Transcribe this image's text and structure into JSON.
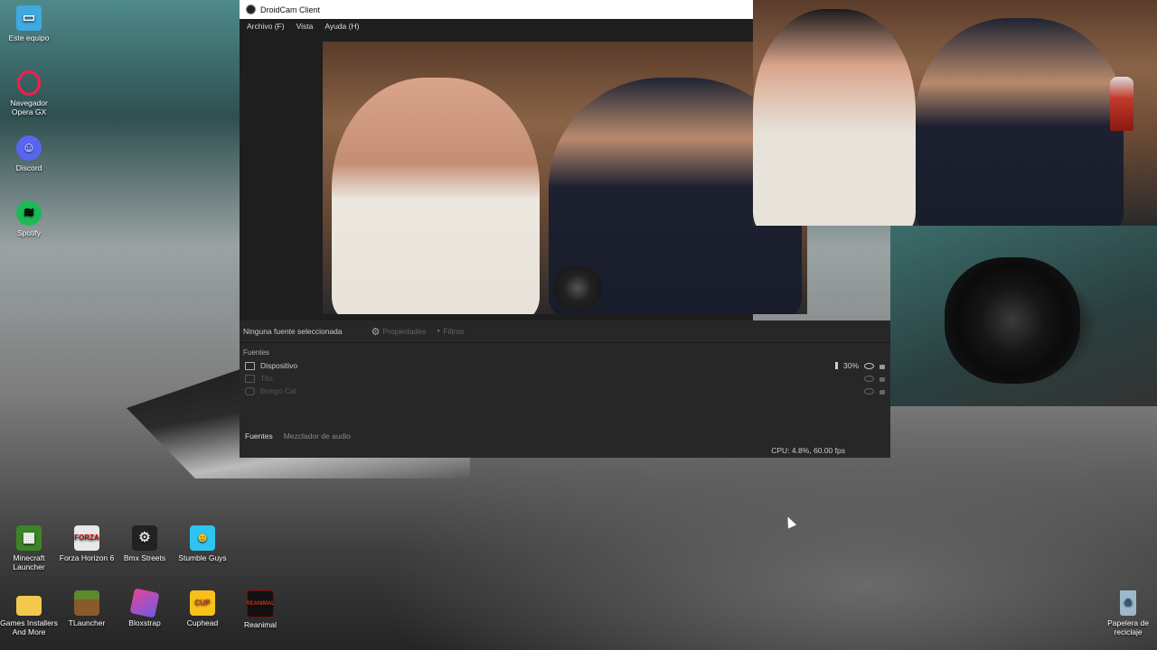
{
  "desktop_icons": [
    {
      "label": "Este equipo",
      "icon": "monitor-icon",
      "color": "#3fa9e0"
    },
    {
      "label": "Navegador Opera GX",
      "icon": "opera-gx-icon",
      "color": "#ff1b4d"
    },
    {
      "label": "Discord",
      "icon": "discord-icon",
      "color": "#5865f2"
    },
    {
      "label": "Spotify",
      "icon": "spotify-icon",
      "color": "#1db954"
    },
    {
      "label": "Minecraft Launcher",
      "icon": "minecraft-icon",
      "color": "#3c8527"
    },
    {
      "label": "Forza Horizon 6",
      "icon": "forza-icon",
      "color": "#e8e8e8"
    },
    {
      "label": "Bmx Streets",
      "icon": "gear-icon",
      "color": "#222222"
    },
    {
      "label": "Stumble Guys",
      "icon": "stumble-guys-icon",
      "color": "#2ec4f1"
    },
    {
      "label": "Games Installers And More",
      "icon": "folder-icon",
      "color": "#f2c94c"
    },
    {
      "label": "TLauncher",
      "icon": "grass-block-icon",
      "color": "#5c8a2c"
    },
    {
      "label": "Bloxstrap",
      "icon": "bloxstrap-icon",
      "color": "#8e44ad"
    },
    {
      "label": "Cuphead",
      "icon": "cuphead-icon",
      "color": "#f6c21a"
    },
    {
      "label": "Reanimal",
      "icon": "reanimal-icon",
      "color": "#8b0000"
    },
    {
      "label": "Papelera de reciclaje",
      "icon": "recycle-bin-icon",
      "color": "#9fb8c8"
    }
  ],
  "window": {
    "title": "DroidCam Client",
    "menu": [
      "Archivo (F)",
      "Vista",
      "Ayuda (H)"
    ]
  },
  "panel": {
    "no_source": "Ninguna fuente seleccionada",
    "properties": "Propiedades",
    "filters": "Filtros",
    "sources_label": "Fuentes",
    "sources": [
      {
        "name": "Dispositivo",
        "volume": "30%",
        "active": true
      },
      {
        "name": "Tito",
        "volume": "",
        "active": false
      },
      {
        "name": "Bongo Cat",
        "volume": "",
        "active": false
      }
    ],
    "tabs": [
      "Fuentes",
      "Mezclador de audio"
    ],
    "status": "CPU: 4.8%, 60.00 fps"
  }
}
